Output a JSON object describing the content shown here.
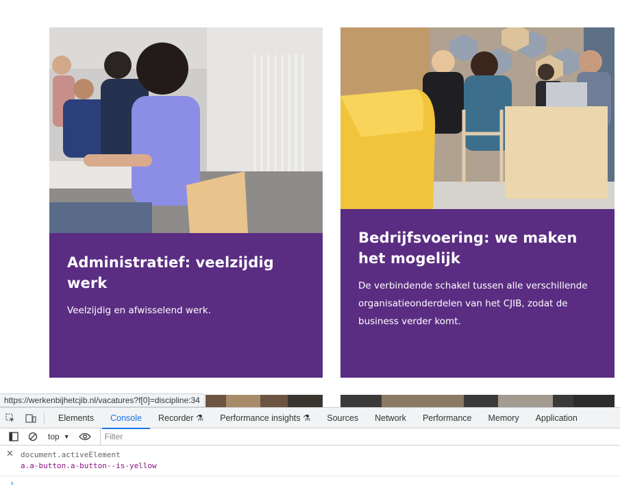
{
  "cards": [
    {
      "title": "Administratief: veelzijdig werk",
      "description": "Veelzijdig en afwisselend werk."
    },
    {
      "title": "Bedrijfsvoering: we maken het mogelijk",
      "description": "De verbindende schakel tussen alle verschillende organisatieonderdelen van het CJIB, zodat de business verder komt."
    }
  ],
  "colors": {
    "card_panel": "#5a2d82",
    "devtools_active": "#1a73e8"
  },
  "status_bar": {
    "url": "https://werkenbijhetcjib.nl/vacatures?f[0]=discipline:34"
  },
  "devtools": {
    "tabs": [
      "Elements",
      "Console",
      "Recorder",
      "Performance insights",
      "Sources",
      "Network",
      "Performance",
      "Memory",
      "Application"
    ],
    "active_tab": "Console",
    "toolbar": {
      "context": "top",
      "filter_placeholder": "Filter"
    },
    "console": {
      "input": "document.activeElement",
      "output": "a.a-button.a-button--is-yellow"
    }
  }
}
